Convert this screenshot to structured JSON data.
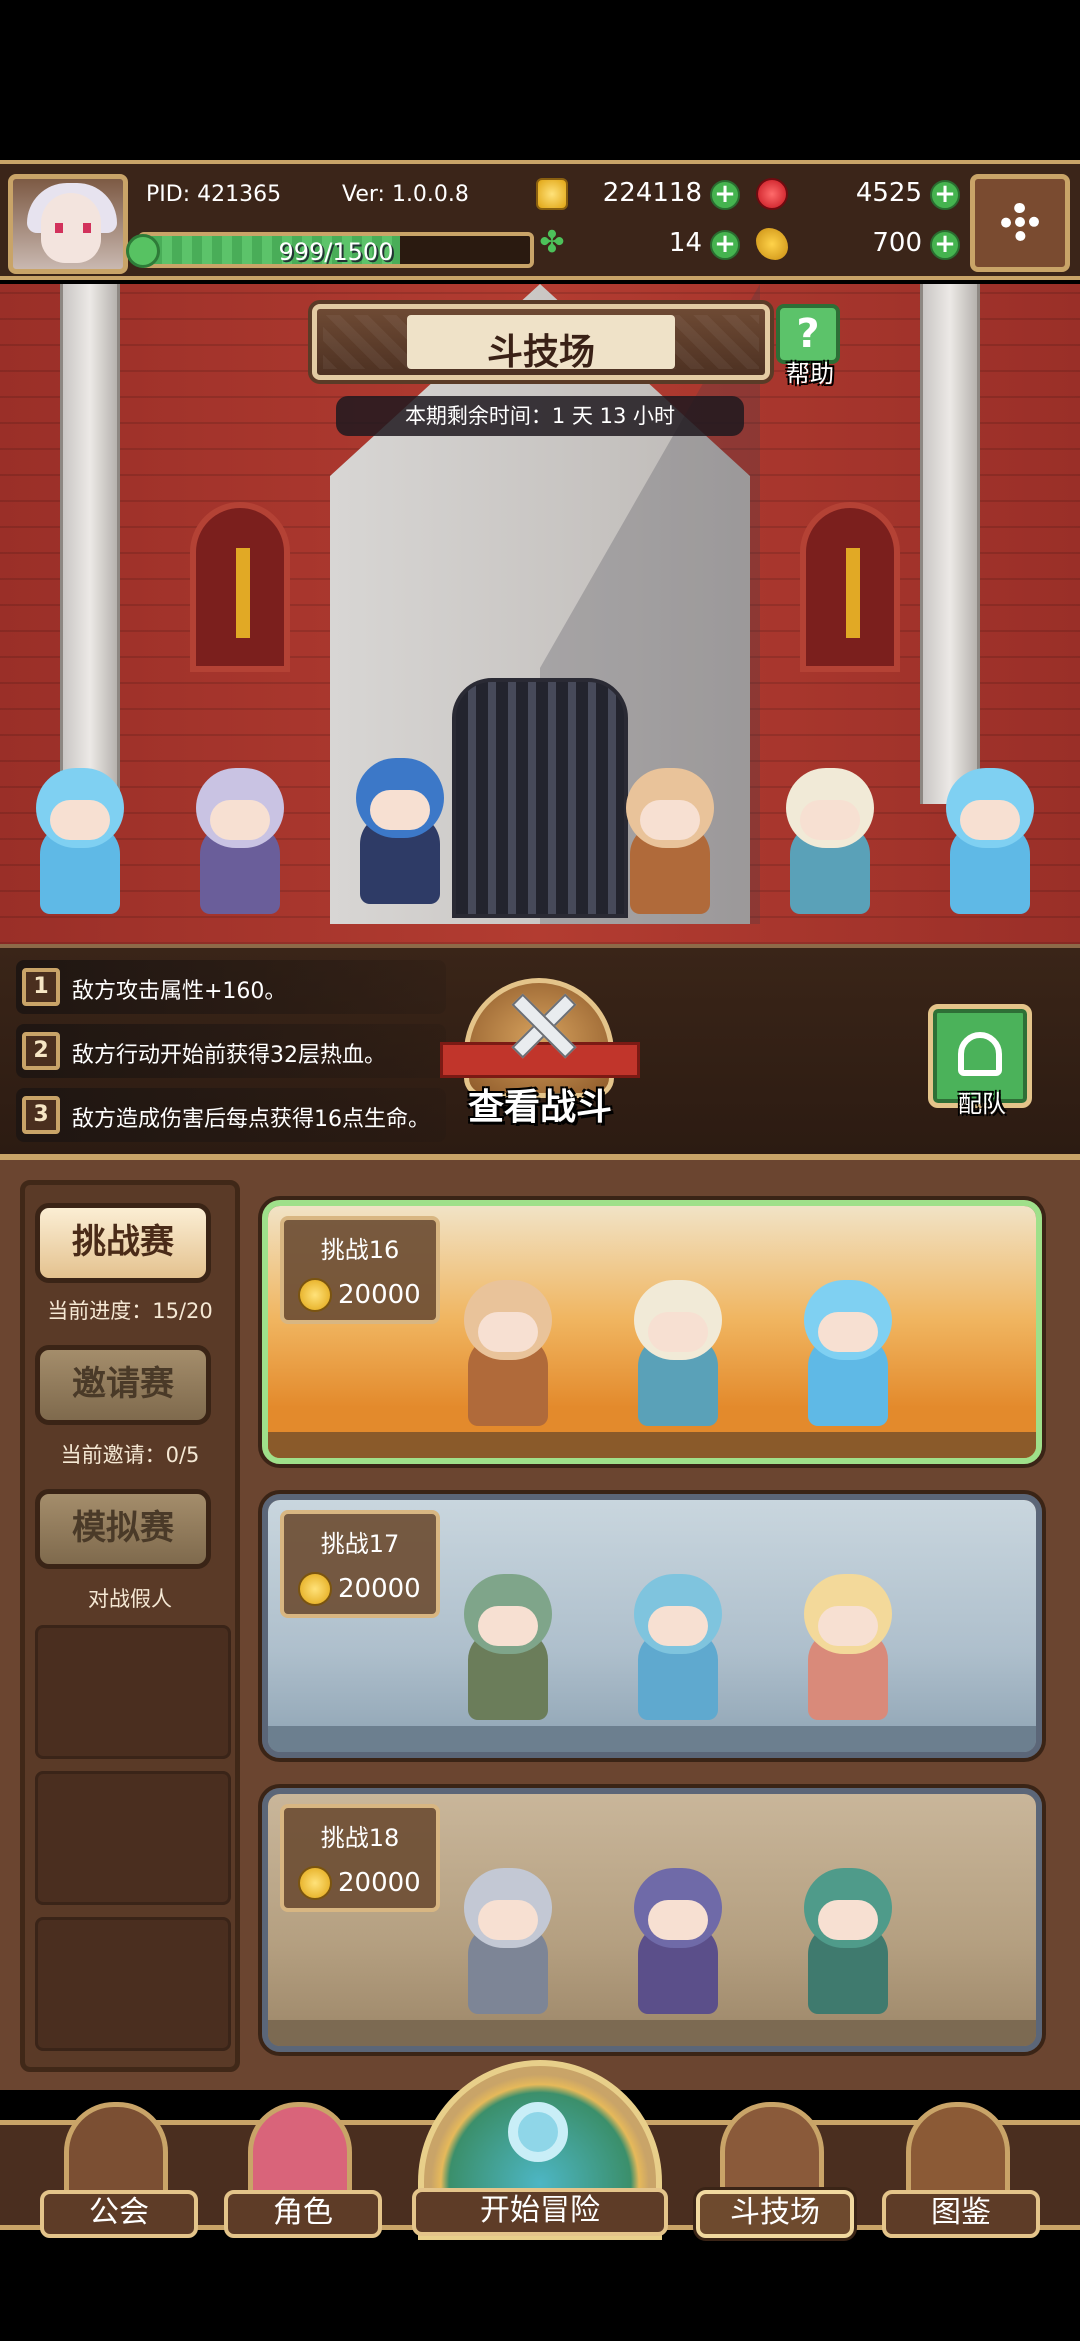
{
  "hud": {
    "pid": "PID: 421365",
    "version": "Ver: 1.0.0.8",
    "xp_text": "999/1500",
    "xp_fraction": 0.666,
    "gold": "224118",
    "gems": "4525",
    "clover": "14",
    "food": "700",
    "plus": "+",
    "icons": {
      "gold": "gold-coin-icon",
      "gems": "ruby-icon",
      "clover": "clover-icon",
      "food": "food-icon",
      "settings": "gear-icon"
    }
  },
  "scene": {
    "title": "斗技场",
    "help_label": "帮助",
    "help_glyph": "?",
    "timer": "本期剩余时间：1 天 13 小时"
  },
  "modifiers": [
    {
      "num": "1",
      "text": "敌方攻击属性+160。"
    },
    {
      "num": "2",
      "text": "敌方行动开始前获得32层热血。"
    },
    {
      "num": "3",
      "text": "敌方造成伤害后每点获得16点生命。"
    }
  ],
  "watch_battle": "查看战斗",
  "team_label": "配队",
  "modes": [
    {
      "label": "挑战赛",
      "sub": "当前进度：15/20",
      "active": true
    },
    {
      "label": "邀请赛",
      "sub": "当前邀请：0/5",
      "active": false
    },
    {
      "label": "模拟赛",
      "sub": "对战假人",
      "active": false
    }
  ],
  "challenges": [
    {
      "name": "挑战16",
      "cost": "20000",
      "selected": true
    },
    {
      "name": "挑战17",
      "cost": "20000",
      "selected": false
    },
    {
      "name": "挑战18",
      "cost": "20000",
      "selected": false
    }
  ],
  "nav": {
    "guild": "公会",
    "character": "角色",
    "adventure": "开始冒险",
    "arena": "斗技场",
    "codex": "图鉴"
  }
}
